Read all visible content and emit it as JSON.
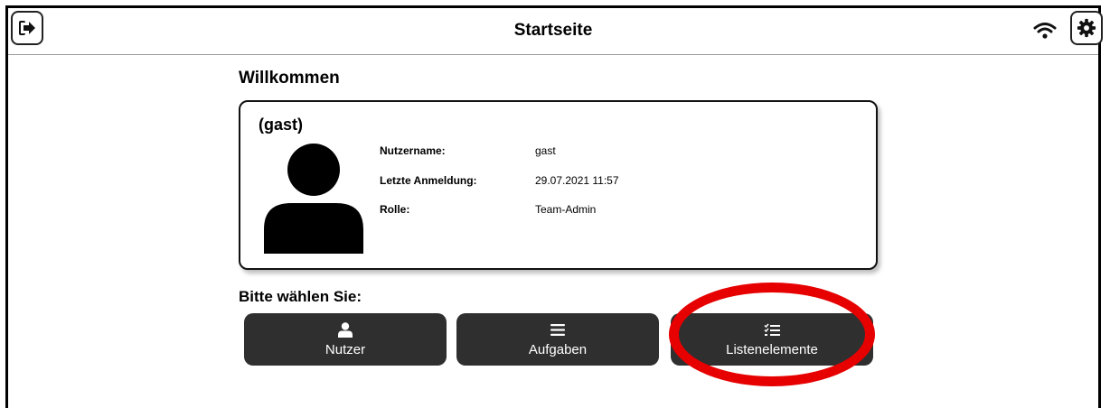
{
  "header": {
    "title": "Startseite",
    "logout_icon": "logout-icon",
    "settings_icon": "gear-icon",
    "wifi_icon": "wifi-icon"
  },
  "welcome": "Willkommen",
  "profile": {
    "name": "(gast)",
    "fields": [
      {
        "label": "Nutzername:",
        "value": "gast"
      },
      {
        "label": "Letzte Anmeldung:",
        "value": "29.07.2021 11:57"
      },
      {
        "label": "Rolle:",
        "value": "Team-Admin"
      }
    ]
  },
  "choose_label": "Bitte wählen Sie:",
  "tiles": [
    {
      "label": "Nutzer",
      "icon": "user-icon"
    },
    {
      "label": "Aufgaben",
      "icon": "list-icon"
    },
    {
      "label": "Listenelemente",
      "icon": "checklist-icon"
    }
  ],
  "colors": {
    "tile_bg": "#2f2f2f",
    "highlight": "#e60000"
  }
}
